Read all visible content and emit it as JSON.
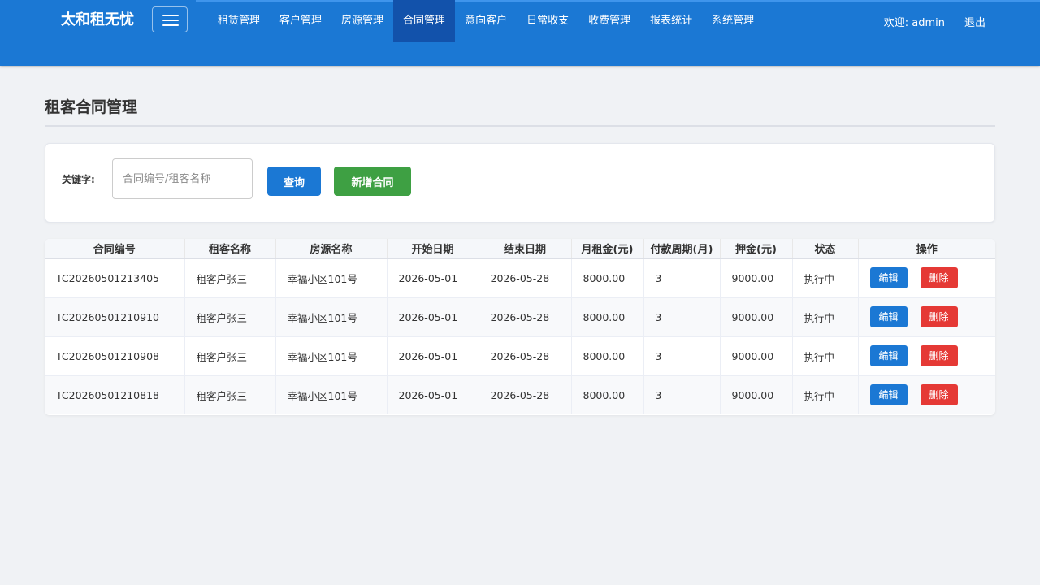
{
  "app": {
    "brand": "太和租无忧"
  },
  "nav": {
    "items": [
      "租赁管理",
      "客户管理",
      "房源管理",
      "合同管理",
      "意向客户",
      "日常收支",
      "收费管理",
      "报表统计",
      "系统管理"
    ],
    "active": "合同管理"
  },
  "user": {
    "welcome": "欢迎: admin",
    "logout": "退出"
  },
  "page": {
    "title": "租客合同管理"
  },
  "search": {
    "label": "关键字:",
    "placeholder": "合同编号/租客名称",
    "value": "",
    "query_button": "查询",
    "add_button": "新增合同"
  },
  "table": {
    "columns": [
      "合同编号",
      "租客名称",
      "房源名称",
      "开始日期",
      "结束日期",
      "月租金(元)",
      "付款周期(月)",
      "押金(元)",
      "状态",
      "操作"
    ],
    "rows": [
      [
        "TC20260501213405",
        "租客户张三",
        "幸福小区101号",
        "2026-05-01",
        "2026-05-28",
        "8000.00",
        "3",
        "9000.00",
        "执行中"
      ],
      [
        "TC20260501210910",
        "租客户张三",
        "幸福小区101号",
        "2026-05-01",
        "2026-05-28",
        "8000.00",
        "3",
        "9000.00",
        "执行中"
      ],
      [
        "TC20260501210908",
        "租客户张三",
        "幸福小区101号",
        "2026-05-01",
        "2026-05-28",
        "8000.00",
        "3",
        "9000.00",
        "执行中"
      ],
      [
        "TC20260501210818",
        "租客户张三",
        "幸福小区101号",
        "2026-05-01",
        "2026-05-28",
        "8000.00",
        "3",
        "9000.00",
        "执行中"
      ]
    ],
    "edit_label": "编辑",
    "delete_label": "删除"
  },
  "colors": {
    "primary": "#1b78d4",
    "nav_active": "#1252ab",
    "success": "#3ea043",
    "danger": "#e53935",
    "background": "#f0f2f5"
  }
}
